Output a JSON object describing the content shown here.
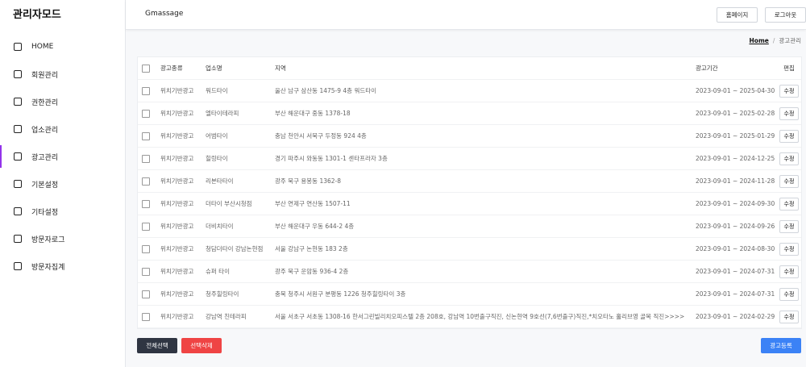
{
  "sidebar": {
    "title": "관리자모드",
    "items": [
      {
        "label": "HOME"
      },
      {
        "label": "회원관리"
      },
      {
        "label": "권한관리"
      },
      {
        "label": "업소관리"
      },
      {
        "label": "광고관리"
      },
      {
        "label": "기본설정"
      },
      {
        "label": "기타설정"
      },
      {
        "label": "방문자로그"
      },
      {
        "label": "방문자집계"
      }
    ],
    "active_index": 4,
    "active_color": "#9333ea"
  },
  "header": {
    "site_name": "Gmassage",
    "home_button": "홈페이지",
    "logout_button": "로그아웃"
  },
  "breadcrumb": {
    "home": "Home",
    "separator": "/",
    "current": "광고관리"
  },
  "table": {
    "columns": {
      "type": "광고종류",
      "name": "업소명",
      "region": "지역",
      "period": "광고기간",
      "edit": "편집"
    },
    "edit_label": "수정",
    "rows": [
      {
        "type": "위치기반광고",
        "name": "워드타이",
        "region": "울산 남구 삼산동 1475-9 4층 워드타이",
        "period": "2023-09-01 ~ 2025-04-30"
      },
      {
        "type": "위치기반광고",
        "name": "엘타이테라피",
        "region": "부산 해운대구 중동 1378-18",
        "period": "2023-09-01 ~ 2025-02-28"
      },
      {
        "type": "위치기반광고",
        "name": "어범타이",
        "region": "충남 천안시 서북구 두정동 924 4층",
        "period": "2023-09-01 ~ 2025-01-29"
      },
      {
        "type": "위치기반광고",
        "name": "힐링타이",
        "region": "경기 파주시 와동동 1301-1 센타프라자 3층",
        "period": "2023-09-01 ~ 2024-12-25"
      },
      {
        "type": "위치기반광고",
        "name": "리본타타이",
        "region": "광주 북구 용봉동 1362-8",
        "period": "2023-09-01 ~ 2024-11-28"
      },
      {
        "type": "위치기반광고",
        "name": "더타이 부산시청점",
        "region": "부산 연제구 연산동 1507-11",
        "period": "2023-09-01 ~ 2024-09-30"
      },
      {
        "type": "위치기반광고",
        "name": "더비치타이",
        "region": "부산 해운대구 우동 644-2 4층",
        "period": "2023-09-01 ~ 2024-09-26"
      },
      {
        "type": "위치기반광고",
        "name": "청담더타이 강남논현점",
        "region": "서울 강남구 논현동 183 2층",
        "period": "2023-09-01 ~ 2024-08-30"
      },
      {
        "type": "위치기반광고",
        "name": "슈퍼 타이",
        "region": "광주 북구 운암동 936-4 2층",
        "period": "2023-09-01 ~ 2024-07-31"
      },
      {
        "type": "위치기반광고",
        "name": "청주힐링타이",
        "region": "충북 청주시 서원구 분평동 1226 청주힐링타이 3층",
        "period": "2023-09-01 ~ 2024-07-31"
      },
      {
        "type": "위치기반광고",
        "name": "강남역 친테라피",
        "region": "서울 서초구 서초동 1308-16 한서그린빌리치오피스텔 2층 208호, 강남역 10번출구직진, 신논현역 9호선(7,6번출구)직진,*치오타노 홀리브영 골목 직진>>>>",
        "period": "2023-09-01 ~ 2024-02-29"
      }
    ]
  },
  "footer": {
    "select_all": "전체선택",
    "delete_selected": "선택삭제",
    "register": "광고등록"
  },
  "colors": {
    "select_all_bg": "#2f3542",
    "delete_bg": "#ef4444",
    "register_bg": "#3b82f6"
  }
}
